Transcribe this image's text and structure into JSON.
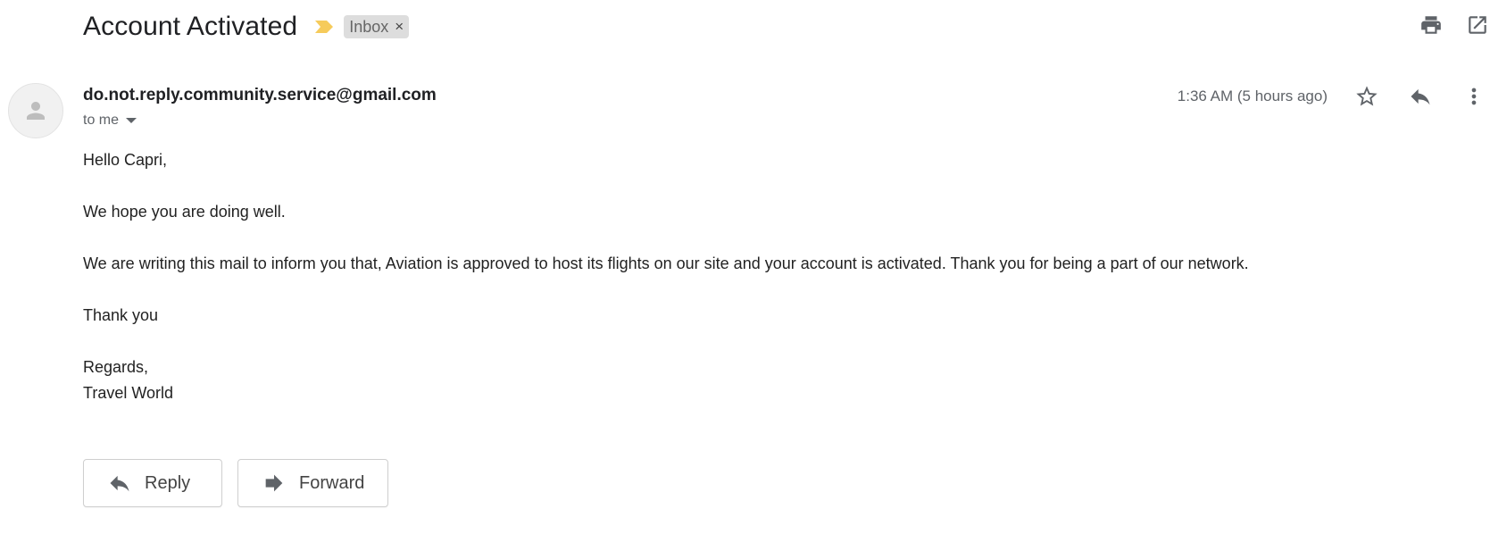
{
  "email": {
    "subject": "Account Activated",
    "label": "Inbox",
    "label_remove": "×",
    "sender": "do.not.reply.community.service@gmail.com",
    "recipient": "to me",
    "timestamp": "1:36 AM (5 hours ago)",
    "body": {
      "greeting": "Hello Capri,",
      "line1": "We hope you are doing well.",
      "line2": "We are writing this mail to inform you that, Aviation is approved to host its flights on our site and your account is activated. Thank you for being a part of our network.",
      "thanks": "Thank you",
      "regards": "Regards,",
      "signature": "Travel World"
    }
  },
  "actions": {
    "reply_label": "Reply",
    "forward_label": "Forward"
  },
  "icons": {
    "importance": "importance-marker-icon",
    "print": "print-icon",
    "open_new_window": "open-in-new-window-icon",
    "star": "star-icon",
    "reply": "reply-icon",
    "more": "more-vertical-icon",
    "avatar": "person-icon",
    "forward": "forward-icon"
  },
  "colors": {
    "importance_marker": "#f6cb5b",
    "label_chip_bg": "#dddddd",
    "icon_gray": "#5f6368"
  }
}
